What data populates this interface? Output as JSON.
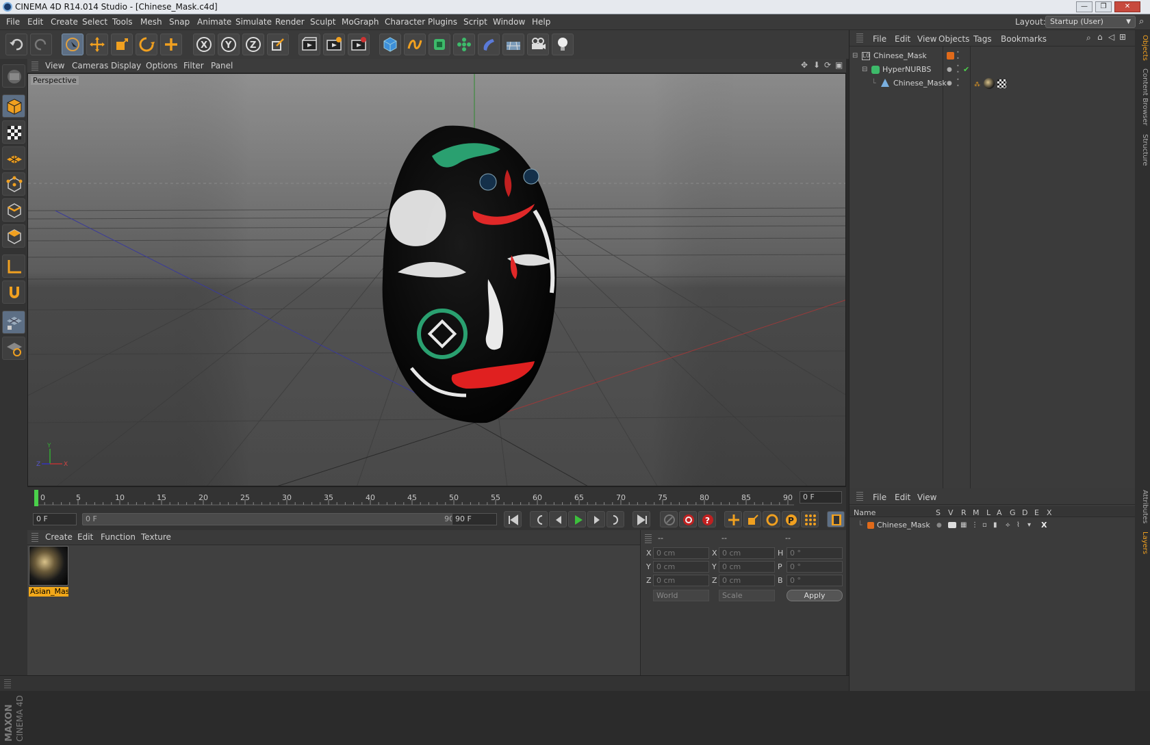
{
  "window": {
    "title": "CINEMA 4D R14.014 Studio - [Chinese_Mask.c4d]",
    "buttons": [
      "—",
      "❐",
      "✕"
    ]
  },
  "menubar": {
    "items": [
      "File",
      "Edit",
      "Create",
      "Select",
      "Tools",
      "Mesh",
      "Snap",
      "Animate",
      "Simulate",
      "Render",
      "Sculpt",
      "MoGraph",
      "Character",
      "Plugins",
      "Script",
      "Window",
      "Help"
    ],
    "layout_label": "Layout:",
    "layout_value": "Startup (User)"
  },
  "toolbar": {
    "icons": [
      "undo-icon",
      "redo-icon",
      "live-selection-icon",
      "move-icon",
      "scale-icon",
      "rotate-icon",
      "add-icon",
      "x-axis-lock-icon",
      "y-axis-lock-icon",
      "z-axis-lock-icon",
      "world-coordinates-icon",
      "render-view-icon",
      "render-picture-viewer-icon",
      "render-settings-icon",
      "cube-primitive-icon",
      "spline-pen-icon",
      "nurbs-icon",
      "array-icon",
      "deformer-icon",
      "floor-scene-icon",
      "camera-icon",
      "light-icon"
    ]
  },
  "left_tools": {
    "icons": [
      "make-editable-icon",
      "model-mode-icon",
      "texture-mode-icon",
      "workplane-icon",
      "points-mode-icon",
      "edges-mode-icon",
      "polygons-mode-icon",
      "axis-mode-icon",
      "snap-magnet-icon",
      "locked-workplane-icon",
      "solo-icon"
    ],
    "brand_line1": "MAXON",
    "brand_line2": "CINEMA 4D"
  },
  "viewport": {
    "menu": [
      "View",
      "Cameras",
      "Display",
      "Options",
      "Filter",
      "Panel"
    ],
    "camera_label": "Perspective",
    "axis_labels": {
      "y": "Y",
      "z": "Z",
      "x": "X"
    }
  },
  "timeline": {
    "ticks": [
      "0",
      "5",
      "10",
      "15",
      "20",
      "25",
      "30",
      "35",
      "40",
      "45",
      "50",
      "55",
      "60",
      "65",
      "70",
      "75",
      "80",
      "85",
      "90"
    ],
    "current_frame": "0 F"
  },
  "transport": {
    "start_field": "0 F",
    "range_start": "0 F",
    "range_end": "90 F",
    "end_field": "90 F"
  },
  "material_manager": {
    "menu": [
      "Create",
      "Edit",
      "Function",
      "Texture"
    ],
    "materials": [
      {
        "name": "Asian_Masl"
      }
    ]
  },
  "coordinates": {
    "headers": [
      "--",
      "--",
      "--"
    ],
    "rows": [
      {
        "a_label": "X",
        "a_val": "0 cm",
        "b_label": "X",
        "b_val": "0 cm",
        "c_label": "H",
        "c_val": "0 °"
      },
      {
        "a_label": "Y",
        "a_val": "0 cm",
        "b_label": "Y",
        "b_val": "0 cm",
        "c_label": "P",
        "c_val": "0 °"
      },
      {
        "a_label": "Z",
        "a_val": "0 cm",
        "b_label": "Z",
        "b_val": "0 cm",
        "c_label": "B",
        "c_val": "0 °"
      }
    ],
    "mode_select": "World",
    "scale_select": "Scale",
    "apply_label": "Apply"
  },
  "object_manager": {
    "menu": [
      "File",
      "Edit",
      "View",
      "Objects",
      "Tags",
      "Bookmarks"
    ],
    "objects": [
      {
        "name": "Chinese_Mask"
      },
      {
        "name": "HyperNURBS"
      },
      {
        "name": "Chinese_Mask"
      }
    ]
  },
  "layer_manager": {
    "menu": [
      "File",
      "Edit",
      "View"
    ],
    "columns": [
      "Name",
      "S",
      "V",
      "R",
      "M",
      "L",
      "A",
      "G",
      "D",
      "E",
      "X"
    ],
    "layers": [
      {
        "name": "Chinese_Mask",
        "color": "#e06a1a"
      }
    ]
  },
  "right_tabs": [
    "Objects",
    "Content Browser",
    "Structure",
    "Attributes",
    "Layers"
  ],
  "colors": {
    "accent": "#f2a81a",
    "selected_tool": "#5d6f85",
    "layer": "#e06a1a"
  }
}
